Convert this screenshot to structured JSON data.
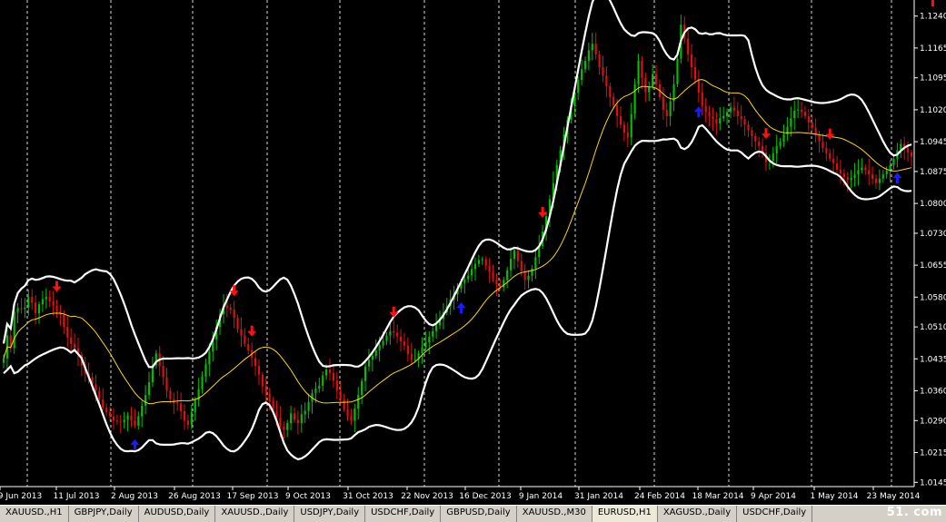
{
  "chart_data": {
    "type": "candlestick",
    "symbol": "EURUSD",
    "timeframe": "Daily",
    "y_ticks": [
      "1.1240",
      "1.1165",
      "1.1095",
      "1.1020",
      "1.0945",
      "1.0875",
      "1.0800",
      "1.0730",
      "1.0655",
      "1.0580",
      "1.0510",
      "1.0435",
      "1.0360",
      "1.0290",
      "1.0215",
      "1.0145"
    ],
    "ylim": [
      1.0135,
      1.1265
    ],
    "x_dates": [
      "9 Jun 2013",
      "11 Jul 2013",
      "2 Aug 2013",
      "26 Aug 2013",
      "17 Sep 2013",
      "9 Oct 2013",
      "31 Oct 2013",
      "22 Nov 2013",
      "16 Dec 2013",
      "9 Jan 2014",
      "31 Jan 2014",
      "24 Feb 2014",
      "18 Mar 2014",
      "9 Apr 2014",
      "1 May 2014",
      "23 May 2014"
    ],
    "closes": [
      1.0436,
      1.049,
      1.046,
      1.0545,
      1.0554,
      1.0552,
      1.0555,
      1.0581,
      1.0567,
      1.0542,
      1.0563,
      1.0575,
      1.0581,
      1.057,
      1.056,
      1.0547,
      1.0538,
      1.051,
      1.0485,
      1.047,
      1.046,
      1.0445,
      1.042,
      1.04,
      1.0392,
      1.0375,
      1.036,
      1.034,
      1.032,
      1.031,
      1.03,
      1.029,
      1.0288,
      1.0286,
      1.0292,
      1.0302,
      1.029,
      1.0278,
      1.03,
      1.0325,
      1.035,
      1.038,
      1.042,
      1.0448,
      1.0418,
      1.0392,
      1.036,
      1.034,
      1.0332,
      1.033,
      1.0312,
      1.029,
      1.028,
      1.031,
      1.0338,
      1.0364,
      1.0393,
      1.0422,
      1.0452,
      1.048,
      1.051,
      1.054,
      1.056,
      1.0555,
      1.055,
      1.0531,
      1.0505,
      1.049,
      1.047,
      1.0455,
      1.0437,
      1.0418,
      1.0398,
      1.0371,
      1.0354,
      1.0335,
      1.0313,
      1.0297,
      1.0276,
      1.0268,
      1.0284,
      1.0307,
      1.0292,
      1.0284,
      1.0305,
      1.0313,
      1.0334,
      1.0355,
      1.0365,
      1.0372,
      1.0396,
      1.041,
      1.0402,
      1.0384,
      1.036,
      1.0339,
      1.0317,
      1.0302,
      1.029,
      1.0318,
      1.035,
      1.0383,
      1.0417,
      1.0433,
      1.0442,
      1.0455,
      1.0467,
      1.0477,
      1.049,
      1.05,
      1.0497,
      1.0487,
      1.0476,
      1.0466,
      1.0446,
      1.0432,
      1.0433,
      1.0448,
      1.0462,
      1.0474,
      1.0487,
      1.05,
      1.0514,
      1.0529,
      1.0544,
      1.0559,
      1.0574,
      1.0587,
      1.06,
      1.0613,
      1.0622,
      1.0631,
      1.0646,
      1.0658,
      1.0667,
      1.0669,
      1.0654,
      1.0639,
      1.0622,
      1.061,
      1.0603,
      1.062,
      1.0643,
      1.067,
      1.069,
      1.0665,
      1.0641,
      1.062,
      1.063,
      1.0647,
      1.0674,
      1.07,
      1.0734,
      1.077,
      1.081,
      1.0848,
      1.089,
      1.0925,
      1.0962,
      1.0997,
      1.103,
      1.106,
      1.109,
      1.1115,
      1.1135,
      1.116,
      1.1175,
      1.115,
      1.112,
      1.11,
      1.1075,
      1.105,
      1.103,
      1.1005,
      1.0985,
      1.0966,
      1.0955,
      1.101,
      1.108,
      1.1135,
      1.1095,
      1.1061,
      1.1075,
      1.1104,
      1.108,
      1.105,
      1.102,
      1.1005,
      1.104,
      1.108,
      1.114,
      1.122,
      1.1187,
      1.115,
      1.112,
      1.1091,
      1.106,
      1.1029,
      1.1015,
      1.1005,
      1.0998,
      1.0988,
      1.1,
      1.1005,
      1.1015,
      1.1025,
      1.1018,
      1.1005,
      1.0998,
      1.0985,
      1.0972,
      1.0958,
      1.0945,
      1.0935,
      1.0919,
      1.0898,
      1.09,
      1.0918,
      1.0935,
      1.0945,
      1.0962,
      1.098,
      1.1,
      1.1018,
      1.102,
      1.1015,
      1.1005,
      1.099,
      1.0977,
      1.096,
      1.0945,
      1.093,
      1.0918,
      1.0905,
      1.0894,
      1.088,
      1.087,
      1.0862,
      1.0855,
      1.086,
      1.0868,
      1.0878,
      1.0884,
      1.0878,
      1.0868,
      1.0858,
      1.0848,
      1.0858,
      1.0868,
      1.0877,
      1.089,
      1.0905,
      1.0925,
      1.094,
      1.093,
      1.092,
      1.091
    ],
    "series": [
      {
        "name": "Bollinger upper",
        "color": "#ffffff"
      },
      {
        "name": "Bollinger middle",
        "color": "#ffd700"
      },
      {
        "name": "Bollinger lower",
        "color": "#ffffff"
      }
    ],
    "colors": {
      "up": "#00c000",
      "down": "#e01010",
      "arrow_down": "#ff1010",
      "arrow_up": "#1a1aff",
      "grid": "#ffffff",
      "text": "#ffffff",
      "background": "#000000"
    },
    "sell_arrow_indices": [
      15,
      65,
      70,
      110,
      152,
      215,
      233,
      262,
      305
    ],
    "buy_arrow_indices": [
      37,
      129,
      196,
      252,
      280,
      290,
      293
    ],
    "grid": "vertical-dotted"
  },
  "tabs": [
    {
      "label": "XAUUSD.,H1"
    },
    {
      "label": "GBPJPY,Daily"
    },
    {
      "label": "AUDUSD,Daily"
    },
    {
      "label": "XAUUSD.,Daily"
    },
    {
      "label": "USDJPY,Daily"
    },
    {
      "label": "USDCHF,Daily"
    },
    {
      "label": "GBPUSD,Daily"
    },
    {
      "label": "XAUUSD.,M30"
    },
    {
      "label": "EURUSD,H1"
    },
    {
      "label": "XAGUSD.,Daily"
    },
    {
      "label": "USDCHF,Daily"
    }
  ],
  "active_tab_index": 8,
  "watermark": "51. com"
}
